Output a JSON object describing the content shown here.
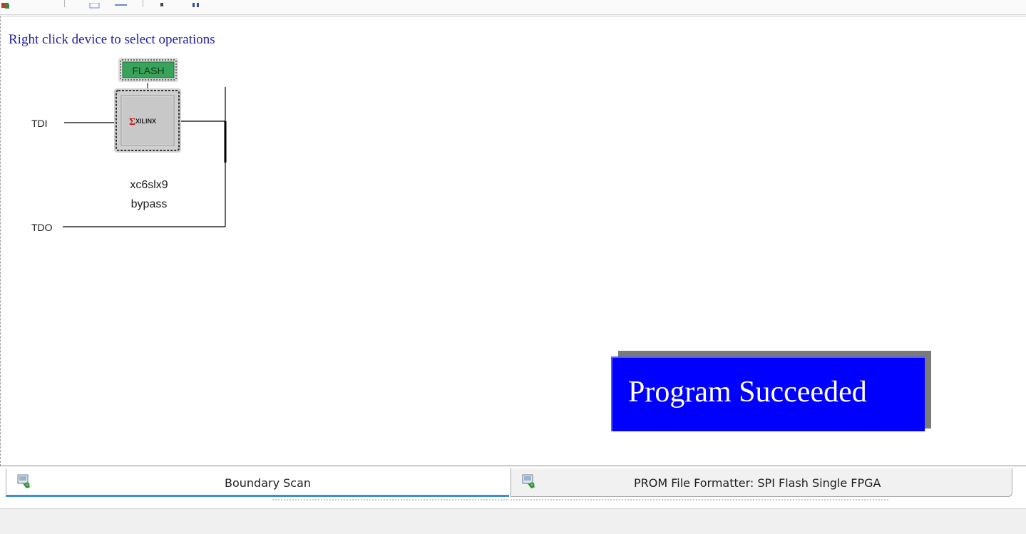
{
  "scan_area": {
    "hint": "Right click device to select operations",
    "tdi_label": "TDI",
    "tdo_label": "TDO",
    "flash_label": "FLASH",
    "chip_logo": "XILINX",
    "device_name": "xc6slx9",
    "device_mode": "bypass"
  },
  "banner": {
    "text": "Program Succeeded",
    "color": "#0000ff"
  },
  "tabs": [
    {
      "label": "Boundary Scan",
      "icon": "chip-programmer-icon",
      "active": true
    },
    {
      "label": "PROM File Formatter: SPI Flash Single FPGA",
      "icon": "chip-programmer-icon",
      "active": false
    }
  ],
  "colors": {
    "hint_text": "#1f1fa6",
    "flash_fill": "#3aa35a",
    "tab_active_underline": "#3c8fd0"
  }
}
